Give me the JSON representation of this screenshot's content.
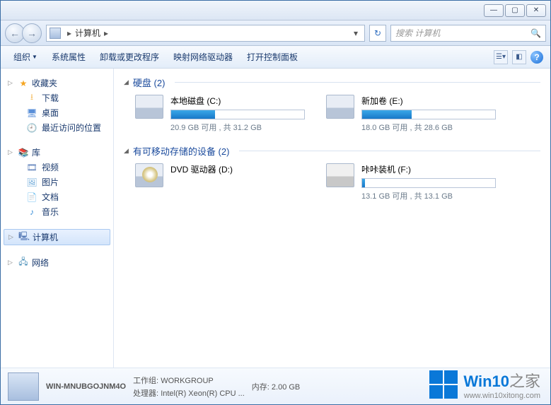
{
  "window_controls": {
    "min": "—",
    "max": "▢",
    "close": "✕"
  },
  "breadcrumb": {
    "label": "计算机",
    "sep": "▸"
  },
  "search": {
    "placeholder": "搜索 计算机"
  },
  "toolbar": {
    "organize": "组织",
    "properties": "系统属性",
    "uninstall": "卸载或更改程序",
    "map_drive": "映射网络驱动器",
    "control_panel": "打开控制面板"
  },
  "sidebar": {
    "favorites": {
      "label": "收藏夹",
      "items": [
        "下载",
        "桌面",
        "最近访问的位置"
      ]
    },
    "libraries": {
      "label": "库",
      "items": [
        "视频",
        "图片",
        "文档",
        "音乐"
      ]
    },
    "computer": {
      "label": "计算机"
    },
    "network": {
      "label": "网络"
    }
  },
  "groups": {
    "drives": {
      "label": "硬盘 (2)",
      "items": [
        {
          "name": "本地磁盘 (C:)",
          "stat": "20.9 GB 可用 , 共 31.2 GB",
          "used_pct": 33
        },
        {
          "name": "新加卷 (E:)",
          "stat": "18.0 GB 可用 , 共 28.6 GB",
          "used_pct": 37
        }
      ]
    },
    "removable": {
      "label": "有可移动存储的设备 (2)",
      "items": [
        {
          "name": "DVD 驱动器 (D:)",
          "type": "dvd"
        },
        {
          "name": "咔咔装机 (F:)",
          "stat": "13.1 GB 可用 , 共 13.1 GB",
          "used_pct": 2,
          "type": "usb"
        }
      ]
    }
  },
  "status": {
    "name": "WIN-MNUBGOJNM4O",
    "workgroup_label": "工作组:",
    "workgroup": "WORKGROUP",
    "cpu_label": "处理器:",
    "cpu": "Intel(R) Xeon(R) CPU ...",
    "mem_label": "内存:",
    "mem": "2.00 GB"
  },
  "watermark": {
    "brand": "Win10",
    "suffix": "之家",
    "url": "www.win10xitong.com"
  }
}
